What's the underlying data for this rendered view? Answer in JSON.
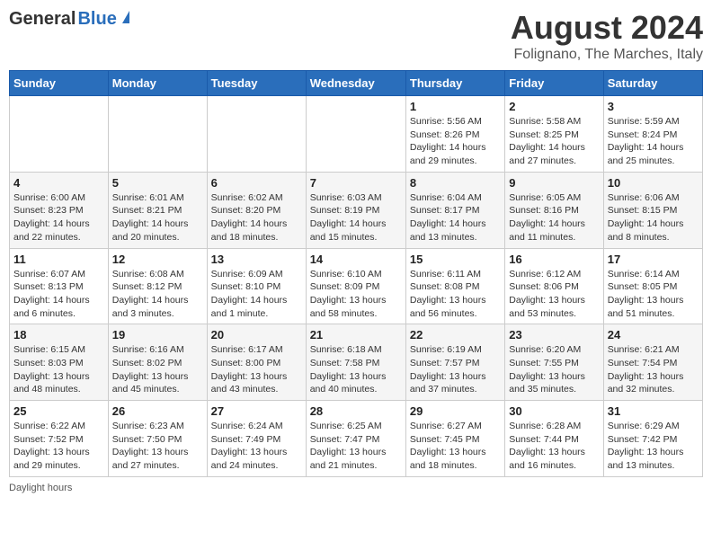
{
  "header": {
    "logo": {
      "general": "General",
      "blue": "Blue"
    },
    "title": "August 2024",
    "location": "Folignano, The Marches, Italy"
  },
  "days_of_week": [
    "Sunday",
    "Monday",
    "Tuesday",
    "Wednesday",
    "Thursday",
    "Friday",
    "Saturday"
  ],
  "weeks": [
    [
      {
        "day": "",
        "info": ""
      },
      {
        "day": "",
        "info": ""
      },
      {
        "day": "",
        "info": ""
      },
      {
        "day": "",
        "info": ""
      },
      {
        "day": "1",
        "info": "Sunrise: 5:56 AM\nSunset: 8:26 PM\nDaylight: 14 hours and 29 minutes."
      },
      {
        "day": "2",
        "info": "Sunrise: 5:58 AM\nSunset: 8:25 PM\nDaylight: 14 hours and 27 minutes."
      },
      {
        "day": "3",
        "info": "Sunrise: 5:59 AM\nSunset: 8:24 PM\nDaylight: 14 hours and 25 minutes."
      }
    ],
    [
      {
        "day": "4",
        "info": "Sunrise: 6:00 AM\nSunset: 8:23 PM\nDaylight: 14 hours and 22 minutes."
      },
      {
        "day": "5",
        "info": "Sunrise: 6:01 AM\nSunset: 8:21 PM\nDaylight: 14 hours and 20 minutes."
      },
      {
        "day": "6",
        "info": "Sunrise: 6:02 AM\nSunset: 8:20 PM\nDaylight: 14 hours and 18 minutes."
      },
      {
        "day": "7",
        "info": "Sunrise: 6:03 AM\nSunset: 8:19 PM\nDaylight: 14 hours and 15 minutes."
      },
      {
        "day": "8",
        "info": "Sunrise: 6:04 AM\nSunset: 8:17 PM\nDaylight: 14 hours and 13 minutes."
      },
      {
        "day": "9",
        "info": "Sunrise: 6:05 AM\nSunset: 8:16 PM\nDaylight: 14 hours and 11 minutes."
      },
      {
        "day": "10",
        "info": "Sunrise: 6:06 AM\nSunset: 8:15 PM\nDaylight: 14 hours and 8 minutes."
      }
    ],
    [
      {
        "day": "11",
        "info": "Sunrise: 6:07 AM\nSunset: 8:13 PM\nDaylight: 14 hours and 6 minutes."
      },
      {
        "day": "12",
        "info": "Sunrise: 6:08 AM\nSunset: 8:12 PM\nDaylight: 14 hours and 3 minutes."
      },
      {
        "day": "13",
        "info": "Sunrise: 6:09 AM\nSunset: 8:10 PM\nDaylight: 14 hours and 1 minute."
      },
      {
        "day": "14",
        "info": "Sunrise: 6:10 AM\nSunset: 8:09 PM\nDaylight: 13 hours and 58 minutes."
      },
      {
        "day": "15",
        "info": "Sunrise: 6:11 AM\nSunset: 8:08 PM\nDaylight: 13 hours and 56 minutes."
      },
      {
        "day": "16",
        "info": "Sunrise: 6:12 AM\nSunset: 8:06 PM\nDaylight: 13 hours and 53 minutes."
      },
      {
        "day": "17",
        "info": "Sunrise: 6:14 AM\nSunset: 8:05 PM\nDaylight: 13 hours and 51 minutes."
      }
    ],
    [
      {
        "day": "18",
        "info": "Sunrise: 6:15 AM\nSunset: 8:03 PM\nDaylight: 13 hours and 48 minutes."
      },
      {
        "day": "19",
        "info": "Sunrise: 6:16 AM\nSunset: 8:02 PM\nDaylight: 13 hours and 45 minutes."
      },
      {
        "day": "20",
        "info": "Sunrise: 6:17 AM\nSunset: 8:00 PM\nDaylight: 13 hours and 43 minutes."
      },
      {
        "day": "21",
        "info": "Sunrise: 6:18 AM\nSunset: 7:58 PM\nDaylight: 13 hours and 40 minutes."
      },
      {
        "day": "22",
        "info": "Sunrise: 6:19 AM\nSunset: 7:57 PM\nDaylight: 13 hours and 37 minutes."
      },
      {
        "day": "23",
        "info": "Sunrise: 6:20 AM\nSunset: 7:55 PM\nDaylight: 13 hours and 35 minutes."
      },
      {
        "day": "24",
        "info": "Sunrise: 6:21 AM\nSunset: 7:54 PM\nDaylight: 13 hours and 32 minutes."
      }
    ],
    [
      {
        "day": "25",
        "info": "Sunrise: 6:22 AM\nSunset: 7:52 PM\nDaylight: 13 hours and 29 minutes."
      },
      {
        "day": "26",
        "info": "Sunrise: 6:23 AM\nSunset: 7:50 PM\nDaylight: 13 hours and 27 minutes."
      },
      {
        "day": "27",
        "info": "Sunrise: 6:24 AM\nSunset: 7:49 PM\nDaylight: 13 hours and 24 minutes."
      },
      {
        "day": "28",
        "info": "Sunrise: 6:25 AM\nSunset: 7:47 PM\nDaylight: 13 hours and 21 minutes."
      },
      {
        "day": "29",
        "info": "Sunrise: 6:27 AM\nSunset: 7:45 PM\nDaylight: 13 hours and 18 minutes."
      },
      {
        "day": "30",
        "info": "Sunrise: 6:28 AM\nSunset: 7:44 PM\nDaylight: 13 hours and 16 minutes."
      },
      {
        "day": "31",
        "info": "Sunrise: 6:29 AM\nSunset: 7:42 PM\nDaylight: 13 hours and 13 minutes."
      }
    ]
  ],
  "footer": {
    "daylight_label": "Daylight hours"
  }
}
